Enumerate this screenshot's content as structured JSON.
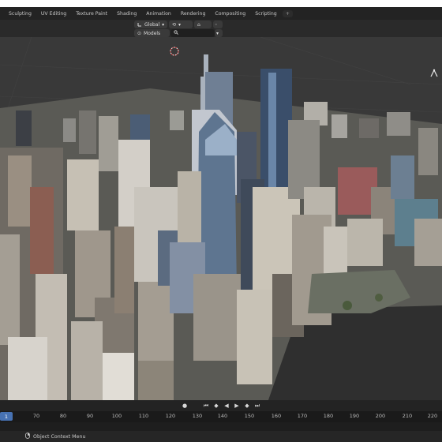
{
  "workspace_tabs": [
    {
      "label": "Sculpting"
    },
    {
      "label": "UV Editing"
    },
    {
      "label": "Texture Paint"
    },
    {
      "label": "Shading"
    },
    {
      "label": "Animation"
    },
    {
      "label": "Rendering"
    },
    {
      "label": "Compositing"
    },
    {
      "label": "Scripting"
    }
  ],
  "add_tab_label": "+",
  "header": {
    "transform_orientation": "Global",
    "collection_label": "Models",
    "search_icon": "search-icon"
  },
  "timeline": {
    "frame_ticks": [
      "60",
      "70",
      "80",
      "90",
      "100",
      "110",
      "120",
      "130",
      "140",
      "150",
      "160",
      "170",
      "180",
      "190",
      "200",
      "210",
      "220"
    ],
    "current_frame": "1"
  },
  "status_bar": {
    "label": "Object Context Menu",
    "icon": "mouse-right-icon"
  },
  "colors": {
    "viewport_bg": "#393939",
    "accent": "#4772b3",
    "cursor": "#e03a3a"
  }
}
